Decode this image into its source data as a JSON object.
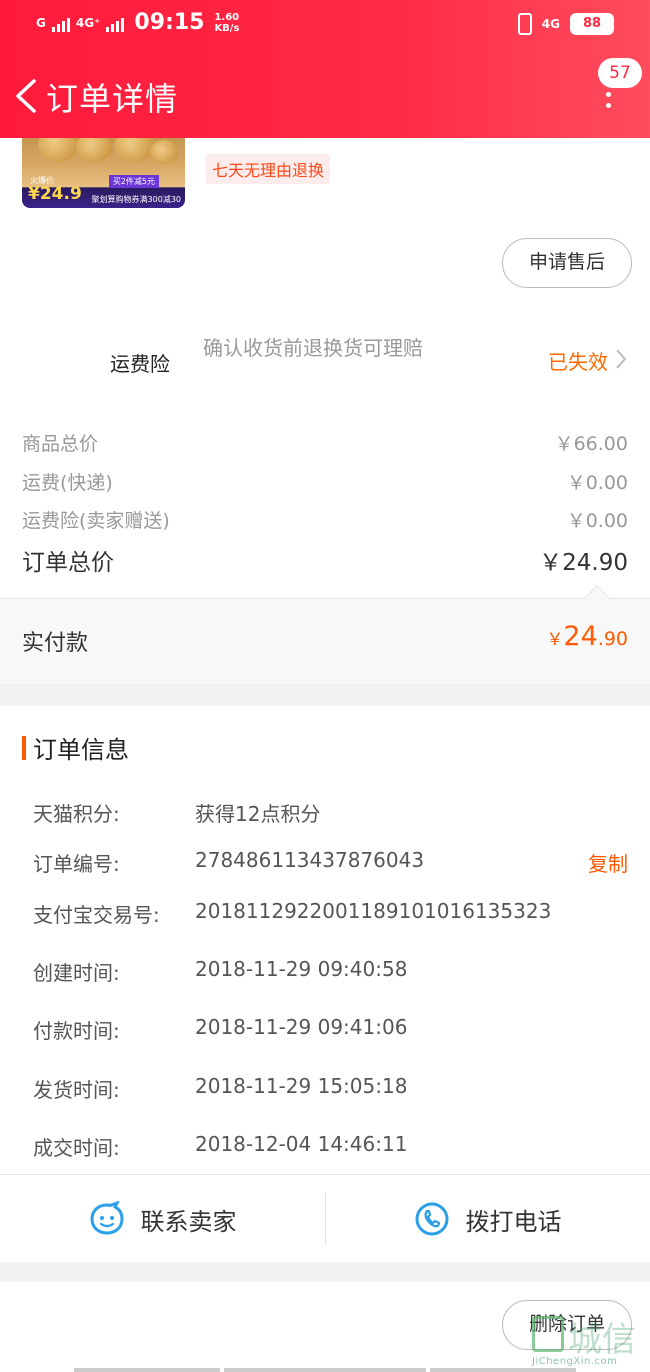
{
  "status_bar": {
    "carrier_left": "G",
    "network_left": "4G⁺",
    "time": "09:15",
    "speed_value": "1.60",
    "speed_unit": "KB/s",
    "network_right": "4G",
    "battery": "88"
  },
  "header": {
    "title": "订单详情",
    "message_count": "57"
  },
  "product": {
    "hot_label": "火爆价",
    "price": "¥24.9",
    "promo_1": "买2件减5元",
    "promo_2": "聚划算购物券满300减30",
    "return_policy": "七天无理由退换",
    "after_sale_button": "申请售后"
  },
  "insurance": {
    "label": "运费险",
    "description": "确认收货前退换货可理赔",
    "status": "已失效"
  },
  "prices": {
    "rows": [
      {
        "label": "商品总价",
        "value": "￥66.00"
      },
      {
        "label": "运费(快递)",
        "value": "￥0.00"
      },
      {
        "label": "运费险(卖家赠送)",
        "value": "￥0.00"
      }
    ],
    "total_label": "订单总价",
    "total_value": "￥24.90",
    "paid_label": "实付款",
    "paid_currency": "￥",
    "paid_integer": "24",
    "paid_decimal": ".90"
  },
  "order_info": {
    "title": "订单信息",
    "copy_label": "复制",
    "rows": [
      {
        "key": "天猫积分:",
        "value": "获得12点积分"
      },
      {
        "key": "订单编号:",
        "value": "278486113437876043"
      },
      {
        "key": "支付宝交易号:",
        "value": "2018112922001189101016135323"
      },
      {
        "key": "创建时间:",
        "value": "2018-11-29 09:40:58"
      },
      {
        "key": "付款时间:",
        "value": "2018-11-29 09:41:06"
      },
      {
        "key": "发货时间:",
        "value": "2018-11-29 15:05:18"
      },
      {
        "key": "成交时间:",
        "value": "2018-12-04 14:46:11"
      }
    ]
  },
  "contact": {
    "seller_label": "联系卖家",
    "phone_label": "拨打电话"
  },
  "bottom": {
    "delete_button": "删除订单"
  },
  "watermark": {
    "text": "城信",
    "url": "JiChengXin.com"
  },
  "colors": {
    "header_red": "#ff2a44",
    "accent_orange": "#ff5a00"
  }
}
